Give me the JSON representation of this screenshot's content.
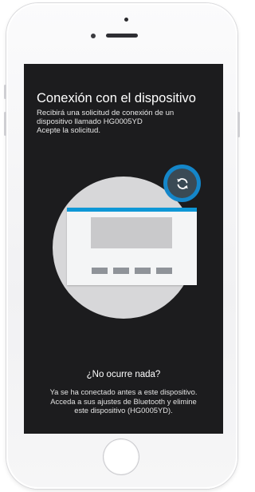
{
  "screen": {
    "title": "Conexión con el dispositivo",
    "subtitle_lines": [
      "Recibirá una solicitud de conexión de un",
      "dispositivo llamado HG0005YD",
      "Acepte la solicitud."
    ],
    "illustration": {
      "icon": "refresh-icon",
      "accent_color": "#1486c9"
    },
    "help": {
      "title": "¿No ocurre nada?",
      "text_lines": [
        "Ya se ha conectado antes a este dispositivo.",
        "Acceda a sus ajustes de Bluetooth y elimine",
        "este dispositivo (HG0005YD)."
      ]
    }
  },
  "colors": {
    "screen_bg": "#1c1c1e",
    "accent": "#0e97d6"
  }
}
